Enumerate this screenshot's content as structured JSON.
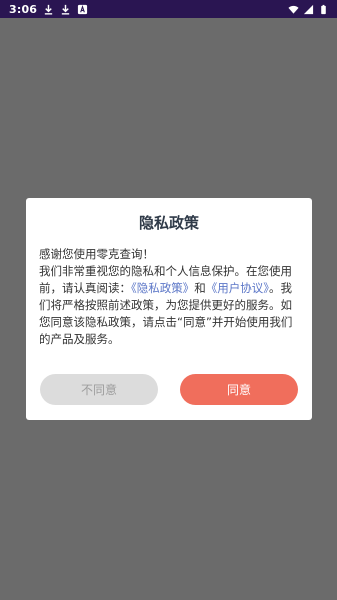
{
  "status_bar": {
    "time": "3:06",
    "icons": [
      "download-icon",
      "download-icon",
      "font-icon",
      "wifi-icon",
      "signal-icon",
      "battery-icon"
    ]
  },
  "dialog": {
    "title": "隐私政策",
    "line1": "感谢您使用零克查询！",
    "text_before_links": "我们非常重视您的隐私和个人信息保护。在您使用前，请认真阅读：",
    "privacy_link": "《隐私政策》",
    "conjunction": "和",
    "user_agreement_link": "《用户协议》",
    "text_after_links": "。我们将严格按照前述政策，为您提供更好的服务。如您同意该隐私政策，请点击“同意”并开始使用我们的产品及服务。",
    "disagree_label": "不同意",
    "agree_label": "同意",
    "colors": {
      "status_bar": "#2a1552",
      "overlay": "#6b6b6b",
      "link": "#5b76c7",
      "agree_button": "#f06e5c",
      "disagree_button": "#dcdcdc"
    }
  }
}
